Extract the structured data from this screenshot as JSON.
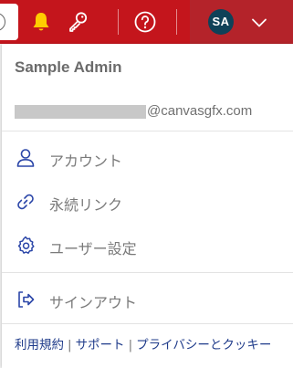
{
  "topbar": {
    "icons": [
      "chevron-left-icon",
      "bell-icon",
      "key-icon",
      "help-icon",
      "chevron-down-icon"
    ],
    "colors": {
      "bar": "#c4151c",
      "profile_bg": "#b4232a",
      "bell": "#ffcc00",
      "avatar_bg": "#0f4158"
    }
  },
  "user": {
    "initials": "SA",
    "name": "Sample Admin",
    "email_domain": "@canvasgfx.com"
  },
  "menu": {
    "account": "アカウント",
    "permalink": "永続リンク",
    "user_settings": "ユーザー設定",
    "sign_out": "サインアウト"
  },
  "footer": {
    "terms": "利用規約",
    "separator": "|",
    "support": "サポート",
    "privacy": "プライバシーとクッキー"
  }
}
